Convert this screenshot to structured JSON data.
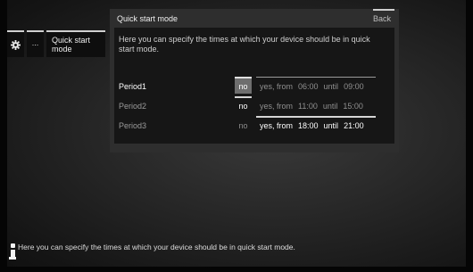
{
  "menu": {
    "items": [
      {
        "icon": "gear-icon"
      },
      {
        "label": "..."
      },
      {
        "label": "Quick start mode"
      }
    ]
  },
  "dialog": {
    "title": "Quick start mode",
    "back_label": "Back",
    "description": "Here you can specify the times at which your device should be in quick start mode.",
    "periods": [
      {
        "label": "Period1",
        "no": "no",
        "yes_from": "yes, from",
        "from_time": "06:00",
        "until": "until",
        "until_time": "09:00",
        "selected": "no"
      },
      {
        "label": "Period2",
        "no": "no",
        "yes_from": "yes, from",
        "from_time": "11:00",
        "until": "until",
        "until_time": "15:00",
        "selected": "no"
      },
      {
        "label": "Period3",
        "no": "no",
        "yes_from": "yes, from",
        "from_time": "18:00",
        "until": "until",
        "until_time": "21:00",
        "selected": "yes"
      }
    ]
  },
  "info": {
    "icon": "info-icon",
    "text": "Here you can specify the times at which your device should be in quick start mode."
  }
}
